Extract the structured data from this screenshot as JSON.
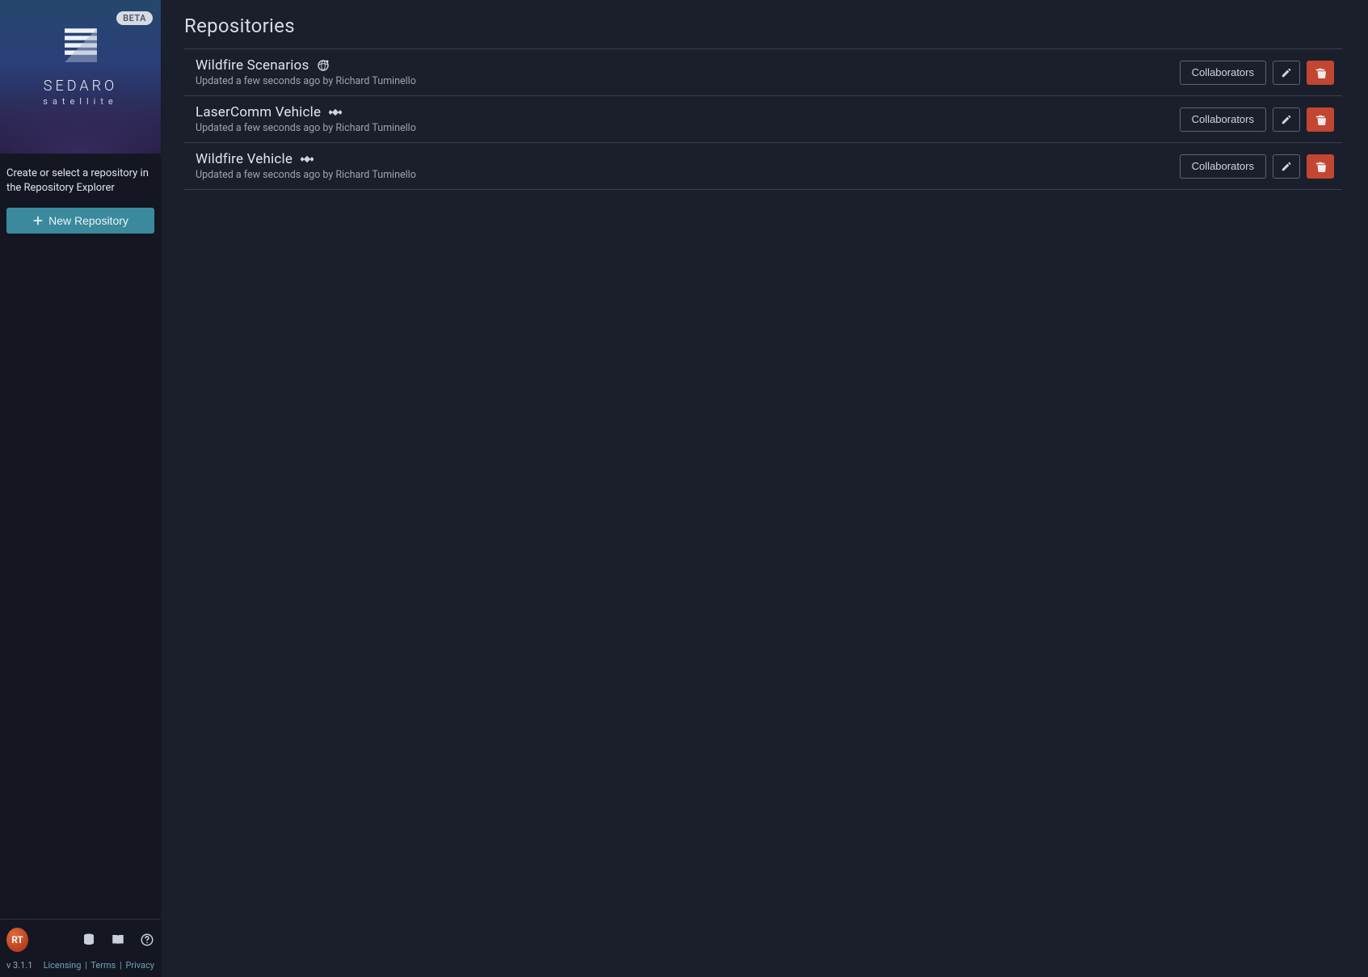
{
  "app": {
    "beta_label": "BETA",
    "name": "SEDARO",
    "subtitle": "satellite"
  },
  "sidebar": {
    "hint": "Create or select a repository in the Repository Explorer",
    "new_repo_label": "New Repository"
  },
  "footer": {
    "avatar_initials": "RT",
    "version": "v 3.1.1",
    "links": {
      "licensing": "Licensing",
      "terms": "Terms",
      "privacy": "Privacy"
    }
  },
  "main": {
    "title": "Repositories",
    "collaborators_label": "Collaborators",
    "repos": [
      {
        "name": "Wildfire Scenarios",
        "type": "scenario",
        "meta": "Updated a few seconds ago by Richard Tuminello"
      },
      {
        "name": "LaserComm Vehicle",
        "type": "vehicle",
        "meta": "Updated a few seconds ago by Richard Tuminello"
      },
      {
        "name": "Wildfire Vehicle",
        "type": "vehicle",
        "meta": "Updated a few seconds ago by Richard Tuminello"
      }
    ]
  }
}
